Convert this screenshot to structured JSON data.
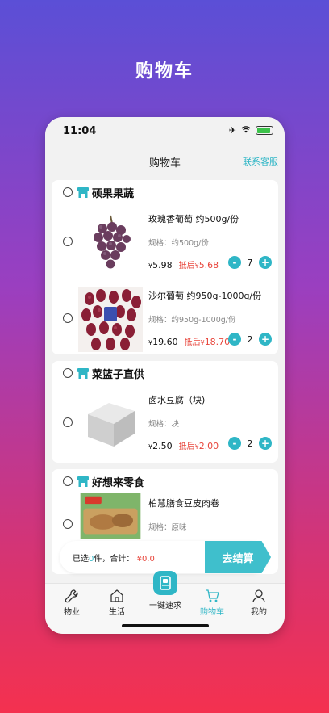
{
  "promo": {
    "title": "购物车"
  },
  "status": {
    "time": "11:04"
  },
  "nav": {
    "title": "购物车",
    "service": "联系客服"
  },
  "shops": [
    {
      "name": "硕果果蔬",
      "items": [
        {
          "name": "玫瑰香葡萄 约500g/份",
          "spec": "规格：约500g/份",
          "price_symbol": "¥",
          "price": "5.98",
          "after_label": "抵后",
          "after_symbol": "¥",
          "after_price": "5.68",
          "qty": "7",
          "image": "grapes-purple"
        },
        {
          "name": "沙尔葡萄 约950g-1000g/份",
          "spec": "规格：约950g-1000g/份",
          "price_symbol": "¥",
          "price": "19.60",
          "after_label": "抵后",
          "after_symbol": "¥",
          "after_price": "18.70",
          "qty": "2",
          "image": "grapes-red"
        }
      ]
    },
    {
      "name": "菜篮子直供",
      "items": [
        {
          "name": "卤水豆腐（块)",
          "spec": "规格：块",
          "price_symbol": "¥",
          "price": "2.50",
          "after_label": "抵后",
          "after_symbol": "¥",
          "after_price": "2.00",
          "qty": "2",
          "image": "tofu"
        }
      ]
    },
    {
      "name": "好想来零食",
      "items": [
        {
          "name": "柏慧膳食豆皮肉卷",
          "spec": "规格：原味",
          "image": "snack-pack"
        }
      ]
    }
  ],
  "checkout": {
    "selected_prefix": "已选",
    "selected_count": "0",
    "selected_suffix": "件，合计：",
    "total_symbol": "¥",
    "total": "0.0",
    "button": "去结算"
  },
  "tabs": [
    {
      "label": "物业",
      "icon": "wrench-icon",
      "active": false
    },
    {
      "label": "生活",
      "icon": "home-icon",
      "active": false
    },
    {
      "label": "一键速求",
      "icon": "quick-request-icon",
      "active": false
    },
    {
      "label": "购物车",
      "icon": "cart-icon",
      "active": true
    },
    {
      "label": "我的",
      "icon": "user-icon",
      "active": false
    }
  ],
  "colors": {
    "accent": "#2fb6c6",
    "price_red": "#e8463c",
    "background_top": "#5b4fd6",
    "background_bottom": "#f4314f"
  }
}
